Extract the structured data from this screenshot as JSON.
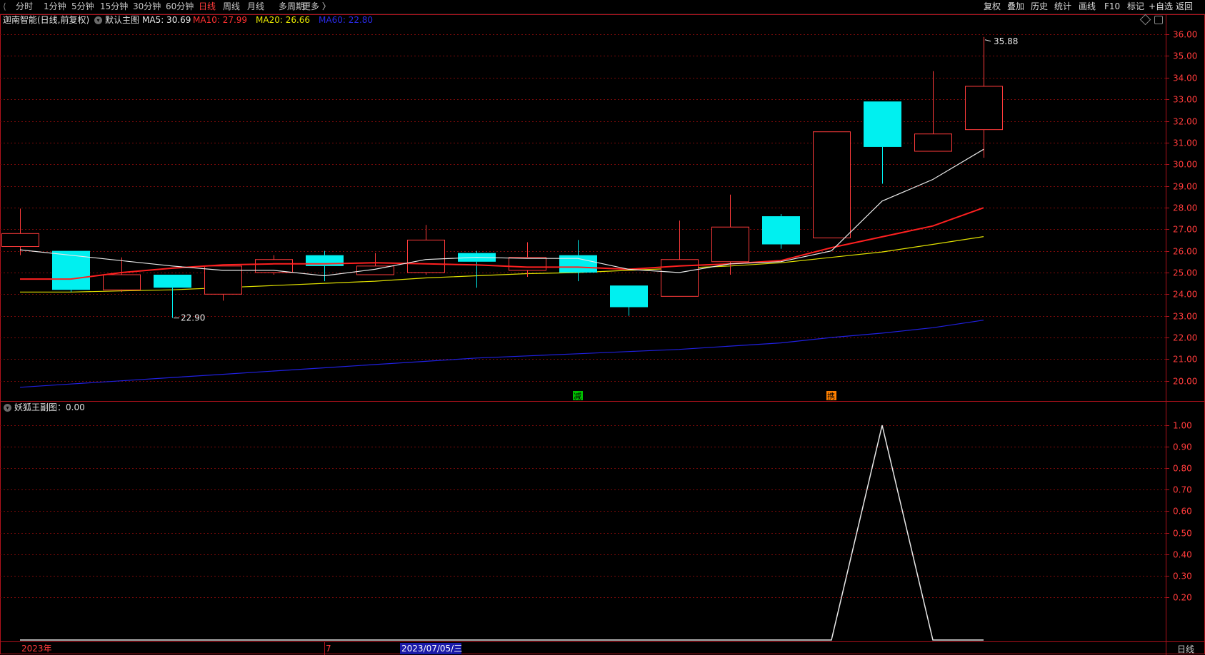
{
  "toolbar": {
    "periods": [
      "分时",
      "1分钟",
      "5分钟",
      "15分钟",
      "30分钟",
      "60分钟",
      "日线",
      "周线",
      "月线",
      "多周期",
      "更多 〉"
    ],
    "active_period": "日线",
    "actions": [
      "复权",
      "叠加",
      "历史",
      "统计",
      "画线",
      "F10",
      "标记",
      "+自选",
      "返回"
    ]
  },
  "main_info": {
    "stock_name": "迦南智能(日线,前复权)",
    "template": "默认主图",
    "ma5_label": "MA5: 30.69",
    "ma10_label": "MA10: 27.99",
    "ma20_label": "MA20: 26.66",
    "ma60_label": "MA60: 22.80"
  },
  "sub_info": {
    "label": "妖狐王副图：0.00"
  },
  "colors": {
    "up": "#ff3b3b",
    "down": "#00f0f0",
    "ma5": "#e8e8e8",
    "ma10": "#ff2020",
    "ma20": "#e0e000",
    "ma60": "#2020e0",
    "grid": "#7a0a0a",
    "axis_text": "#ff3b3b"
  },
  "time_axis": {
    "start_label": "2023年",
    "month_label": "7",
    "cursor_date": "2023/07/05/三"
  },
  "period_label": "日线",
  "signals": [
    {
      "label": "减",
      "index": 11,
      "color": "#00c000"
    },
    {
      "label": "携",
      "index": 16,
      "color": "#ff8000"
    }
  ],
  "annotations": {
    "high": "35.88",
    "low": "22.90"
  },
  "chart_data": {
    "type": "candlestick",
    "price_axis": {
      "ylim": [
        19.1,
        36.4
      ],
      "ticks": [
        "36.00",
        "35.00",
        "34.00",
        "33.00",
        "32.00",
        "31.00",
        "30.00",
        "29.00",
        "28.00",
        "27.00",
        "26.00",
        "25.00",
        "24.00",
        "23.00",
        "22.00",
        "21.00",
        "20.00"
      ]
    },
    "candles": [
      {
        "open": 26.2,
        "close": 26.8,
        "high": 27.95,
        "low": 25.8
      },
      {
        "open": 26.0,
        "close": 24.2,
        "high": 26.0,
        "low": 24.1
      },
      {
        "open": 24.2,
        "close": 24.9,
        "high": 25.7,
        "low": 24.1
      },
      {
        "open": 24.9,
        "close": 24.3,
        "high": 24.9,
        "low": 22.9
      },
      {
        "open": 24.0,
        "close": 25.3,
        "high": 25.3,
        "low": 23.7
      },
      {
        "open": 25.0,
        "close": 25.6,
        "high": 25.8,
        "low": 24.9
      },
      {
        "open": 25.8,
        "close": 25.3,
        "high": 26.0,
        "low": 24.6
      },
      {
        "open": 24.9,
        "close": 25.3,
        "high": 25.9,
        "low": 24.9
      },
      {
        "open": 25.0,
        "close": 26.5,
        "high": 27.2,
        "low": 24.9
      },
      {
        "open": 25.9,
        "close": 25.5,
        "high": 26.0,
        "low": 24.3
      },
      {
        "open": 25.1,
        "close": 25.7,
        "high": 26.4,
        "low": 24.8
      },
      {
        "open": 25.8,
        "close": 25.0,
        "high": 26.5,
        "low": 24.6
      },
      {
        "open": 24.4,
        "close": 23.4,
        "high": 24.4,
        "low": 23.0
      },
      {
        "open": 23.9,
        "close": 25.6,
        "high": 27.4,
        "low": 23.9
      },
      {
        "open": 25.5,
        "close": 27.1,
        "high": 28.6,
        "low": 24.9
      },
      {
        "open": 27.6,
        "close": 26.3,
        "high": 27.7,
        "low": 26.1
      },
      {
        "open": 26.6,
        "close": 31.5,
        "high": 31.5,
        "low": 26.6
      },
      {
        "open": 32.9,
        "close": 30.8,
        "high": 32.9,
        "low": 29.1
      },
      {
        "open": 30.6,
        "close": 31.4,
        "high": 34.3,
        "low": 30.6
      },
      {
        "open": 31.6,
        "close": 33.6,
        "high": 35.88,
        "low": 30.3
      }
    ],
    "ma5": [
      26.05,
      25.8,
      25.55,
      25.3,
      25.1,
      25.1,
      24.85,
      25.15,
      25.6,
      25.7,
      25.65,
      25.65,
      25.15,
      25.0,
      25.4,
      25.5,
      26.0,
      28.3,
      29.3,
      30.69
    ],
    "ma10": [
      24.7,
      24.7,
      25.0,
      25.2,
      25.35,
      25.4,
      25.4,
      25.45,
      25.4,
      25.35,
      25.25,
      25.25,
      25.15,
      25.3,
      25.4,
      25.55,
      26.15,
      26.65,
      27.15,
      27.99
    ],
    "ma20": [
      24.1,
      24.1,
      24.15,
      24.2,
      24.3,
      24.4,
      24.5,
      24.6,
      24.75,
      24.85,
      24.95,
      25.0,
      25.1,
      25.2,
      25.3,
      25.45,
      25.7,
      25.95,
      26.3,
      26.66
    ],
    "ma60": [
      19.7,
      19.85,
      20.0,
      20.15,
      20.3,
      20.45,
      20.6,
      20.75,
      20.9,
      21.05,
      21.15,
      21.25,
      21.35,
      21.45,
      21.6,
      21.75,
      22.0,
      22.2,
      22.45,
      22.8
    ],
    "sub_indicator": {
      "ylim": [
        0.0,
        1.05
      ],
      "ticks": [
        "1.00",
        "0.90",
        "0.80",
        "0.70",
        "0.60",
        "0.50",
        "0.40",
        "0.30",
        "0.20"
      ],
      "values": [
        0,
        0,
        0,
        0,
        0,
        0,
        0,
        0,
        0,
        0,
        0,
        0,
        0,
        0,
        0,
        0,
        0,
        1.0,
        0,
        0
      ]
    }
  }
}
